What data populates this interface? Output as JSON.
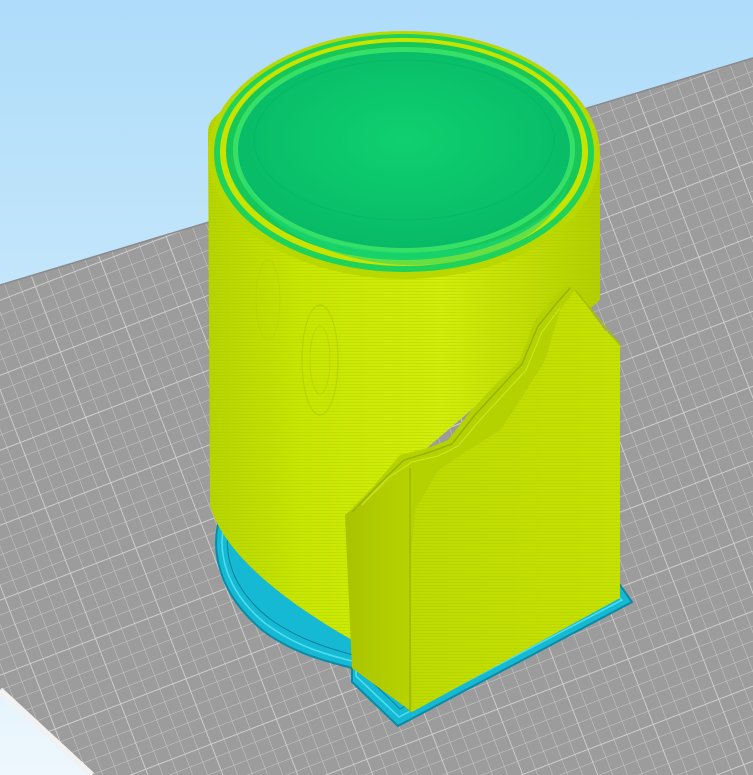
{
  "viewport": {
    "view": "3d-layer-preview",
    "background_sky": "#b8e0fb",
    "background_low": "#eef7fd"
  },
  "build_plate": {
    "color": "#9a9a9a",
    "grid_color": "#c8c8c8"
  },
  "model": {
    "shape": "cylindrical-cup-with-side-block",
    "outer_wall_color": "#c8e600",
    "inner_wall_color": "#11cc6e",
    "rim_color": "#2ede55",
    "skirt_color": "#1ec8dc",
    "skirt_dark_color": "#0d8fa8"
  }
}
